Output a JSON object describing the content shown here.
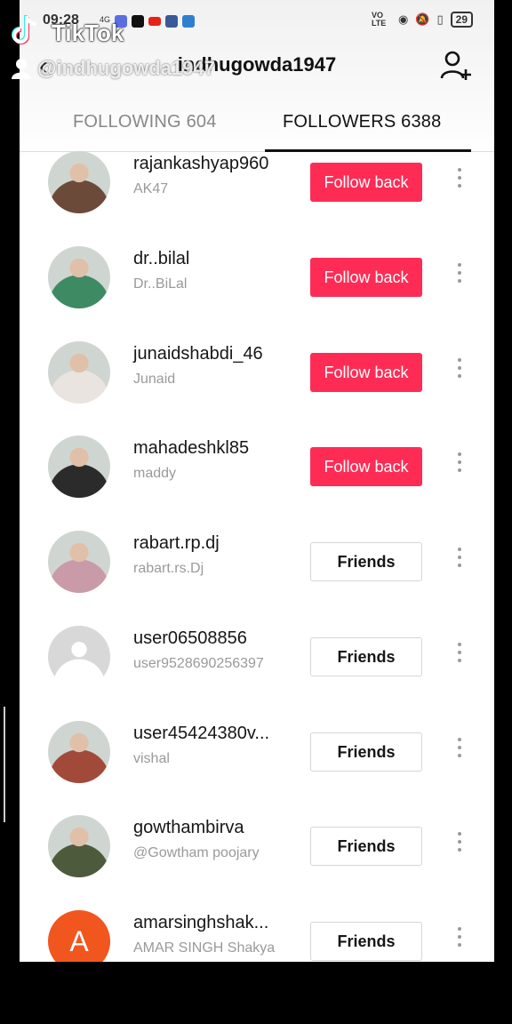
{
  "watermark": {
    "brand": "TikTok",
    "user": "@indhugowda1947"
  },
  "status": {
    "time": "09:28",
    "battery": "29",
    "net": "4G",
    "volte": "VO LTE"
  },
  "header": {
    "title": "indhugowda1947"
  },
  "tabs": {
    "following": "FOLLOWING 604",
    "followers": "FOLLOWERS 6388"
  },
  "colors": {
    "accent": "#fe2c55"
  },
  "users": [
    {
      "username": "rajankashyap960",
      "nickname": "AK47",
      "button": "Follow back",
      "style": "red",
      "avatar": "#6b4a3a"
    },
    {
      "username": "dr..bilal",
      "nickname": "Dr..BiLal",
      "button": "Follow back",
      "style": "red",
      "avatar": "#3e8a63"
    },
    {
      "username": "junaidshabdi_46",
      "nickname": "Junaid",
      "button": "Follow back",
      "style": "red",
      "avatar": "#e9e4df"
    },
    {
      "username": "mahadeshkl85",
      "nickname": "maddy",
      "button": "Follow back",
      "style": "red",
      "avatar": "#2b2b2b"
    },
    {
      "username": "rabart.rp.dj",
      "nickname": "rabart.rs.Dj",
      "button": "Friends",
      "style": "white",
      "avatar": "#c99aa7"
    },
    {
      "username": "user06508856",
      "nickname": "user9528690256397",
      "button": "Friends",
      "style": "white",
      "avatar": "#d8d8d8"
    },
    {
      "username": "user45424380v...",
      "nickname": "vishal",
      "button": "Friends",
      "style": "white",
      "avatar": "#a24a3a"
    },
    {
      "username": "gowthambirva",
      "nickname": "@Gowtham poojary",
      "button": "Friends",
      "style": "white",
      "avatar": "#4e5a3c"
    },
    {
      "username": "amarsinghshak...",
      "nickname": "AMAR SINGH Shakya",
      "button": "Friends",
      "style": "white",
      "avatar": "#f0561d",
      "letter": "A"
    }
  ]
}
